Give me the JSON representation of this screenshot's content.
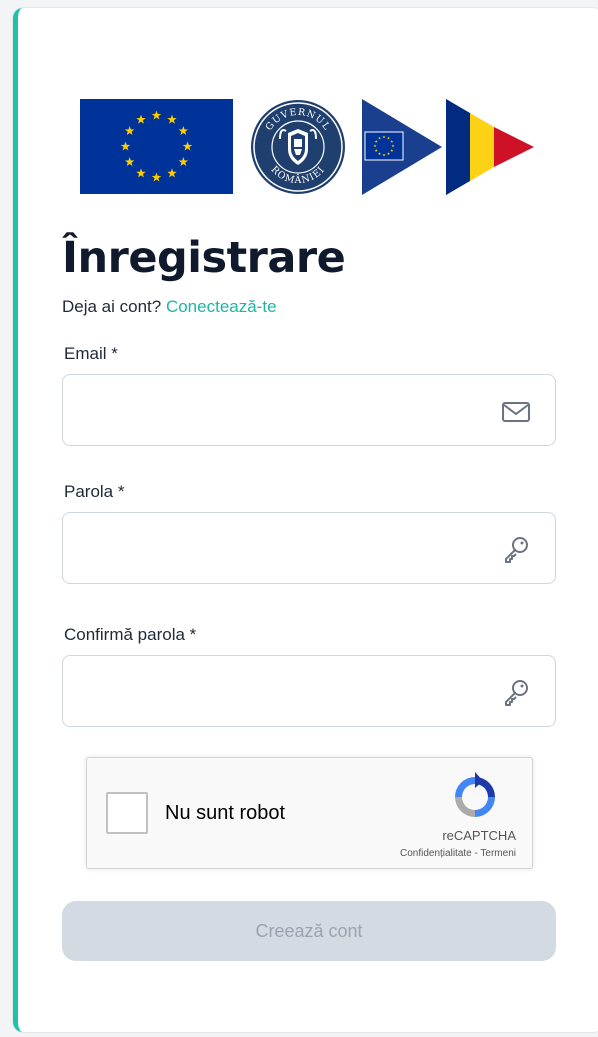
{
  "colors": {
    "accent": "#1fc1ad",
    "link": "#1fb5a3",
    "title": "#101a2c",
    "button_disabled_bg": "#d4dae2",
    "button_disabled_text": "#9aa4b1",
    "eu_blue": "#003399",
    "eu_gold": "#ffcc00",
    "ro_blue": "#002b7f",
    "ro_yellow": "#fcd116",
    "ro_red": "#ce1126"
  },
  "logos": {
    "eu_flag": "eu-flag-logo",
    "government_seal": "guvernul-romaniei-seal",
    "government_seal_text_top": "GUVERNUL",
    "government_seal_text_bottom": "ROMÂNIEI",
    "ro_flag_arrow": "romania-flag-arrow-logo"
  },
  "page": {
    "title": "Înregistrare",
    "subtitle_prefix": "Deja ai cont? ",
    "login_link": "Conectează-te"
  },
  "form": {
    "email": {
      "label": "Email *",
      "value": "",
      "placeholder": "",
      "icon": "envelope-icon"
    },
    "password": {
      "label": "Parola *",
      "value": "",
      "placeholder": "",
      "icon": "key-icon"
    },
    "confirm_password": {
      "label": "Confirmă parola *",
      "value": "",
      "placeholder": "",
      "icon": "key-icon"
    }
  },
  "recaptcha": {
    "label": "Nu sunt robot",
    "brand": "reCAPTCHA",
    "links": "Confidențialitate - Termeni",
    "checked": false
  },
  "submit": {
    "label": "Creează cont",
    "disabled": true
  }
}
